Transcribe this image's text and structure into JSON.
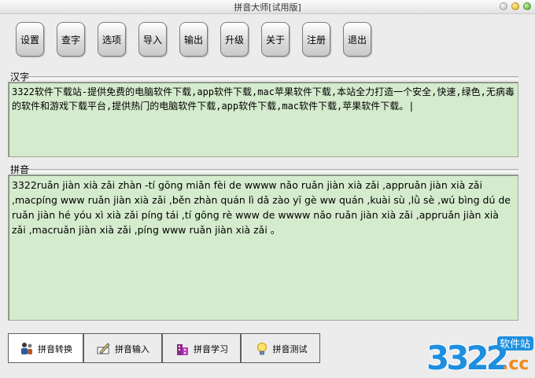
{
  "window": {
    "title": "拼音大师[试用版]"
  },
  "toolbar": {
    "buttons": [
      "设置",
      "查字",
      "选项",
      "导入",
      "输出",
      "升级",
      "关于",
      "注册",
      "退出"
    ]
  },
  "hanzi": {
    "label": "汉字",
    "text": "3322软件下载站-提供免费的电脑软件下载,app软件下载,mac苹果软件下载,本站全力打造一个安全,快速,绿色,无病毒的软件和游戏下载平台,提供热门的电脑软件下载,app软件下载,mac软件下载,苹果软件下载。|"
  },
  "pinyin": {
    "label": "拼音",
    "text": "3322ruǎn jiàn xià zǎi zhàn -tí gōng miǎn fèi de wwww nǎo ruǎn jiàn xià zǎi ,appruǎn jiàn xià zǎi ,macpíng www ruǎn jiàn xià zǎi ,běn zhàn quán lì dǎ zào yī gè ww quán ,kuài sù ,lǜ sè ,wú bìng dú de ruǎn jiàn hé yóu xì xià zǎi píng tái ,tí gōng rè www de wwww nǎo ruǎn jiàn xià zǎi ,appruǎn jiàn xià zǎi ,macruǎn jiàn xià zǎi ,píng www ruǎn jiàn xià zǎi 。"
  },
  "tabs": [
    {
      "label": "拼音转换",
      "icon": "people-icon",
      "active": true
    },
    {
      "label": "拼音输入",
      "icon": "pencil-icon",
      "active": false
    },
    {
      "label": "拼音学习",
      "icon": "building-icon",
      "active": false
    },
    {
      "label": "拼音测试",
      "icon": "lightbulb-icon",
      "active": false
    }
  ],
  "watermark": {
    "number": "3322",
    "tag": "软件站",
    "domain": ".cc"
  },
  "colors": {
    "text_area_bg": "#d5ebcd",
    "logo_blue": "#1e8fe0",
    "logo_orange": "#f08a1c"
  }
}
